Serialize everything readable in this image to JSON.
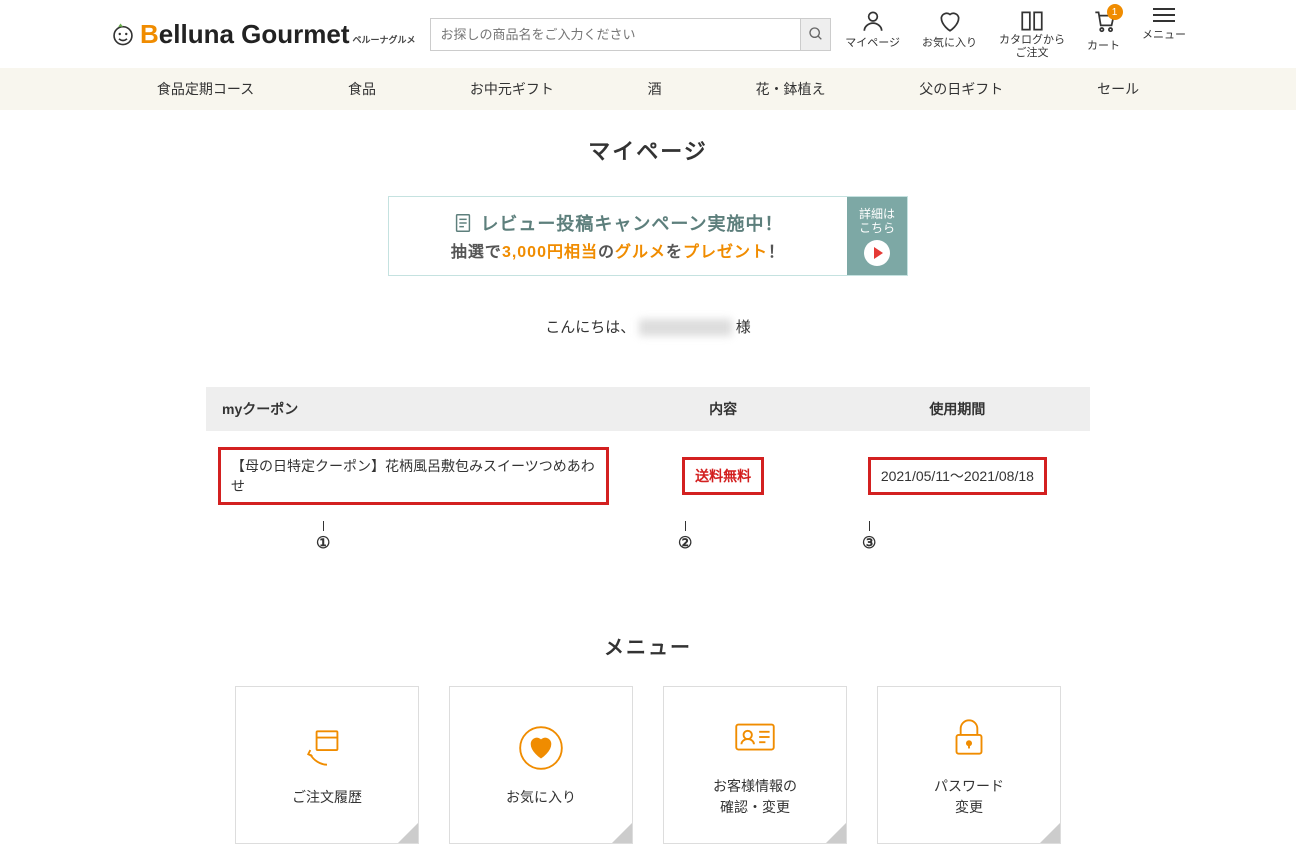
{
  "brand": {
    "name_prefix_b": "B",
    "name_rest": "elluna Gourmet",
    "sub": "ベルーナグルメ"
  },
  "search": {
    "placeholder": "お探しの商品名をご入力ください"
  },
  "header_icons": {
    "mypage": "マイページ",
    "favorite": "お気に入り",
    "catalog_l1": "カタログから",
    "catalog_l2": "ご注文",
    "cart": "カート",
    "cart_badge": "1",
    "menu": "メニュー"
  },
  "nav": [
    "食品定期コース",
    "食品",
    "お中元ギフト",
    "酒",
    "花・鉢植え",
    "父の日ギフト",
    "セール"
  ],
  "page_title": "マイページ",
  "banner": {
    "line1": "レビュー投稿キャンペーン実施中！",
    "line2_a": "抽選で",
    "line2_b": "3,000円相当",
    "line2_c": "の",
    "line2_d": "グルメ",
    "line2_e": "を",
    "line2_f": "プレゼント",
    "line2_g": "！",
    "detail_l1": "詳細は",
    "detail_l2": "こちら"
  },
  "greeting": {
    "prefix": "こんにちは、",
    "suffix": "様"
  },
  "coupon": {
    "headers": [
      "myクーポン",
      "内容",
      "使用期間"
    ],
    "row": {
      "name": "【母の日特定クーポン】花柄風呂敷包みスイーツつめあわせ",
      "content": "送料無料",
      "period": "2021/05/11～2021/08/18"
    }
  },
  "annotations": [
    "①",
    "②",
    "③"
  ],
  "menu_title": "メニュー",
  "menu_cards": {
    "orders": "ご注文履歴",
    "favorite": "お気に入り",
    "customer_l1": "お客様情報の",
    "customer_l2": "確認・変更",
    "password_l1": "パスワード",
    "password_l2": "変更"
  }
}
